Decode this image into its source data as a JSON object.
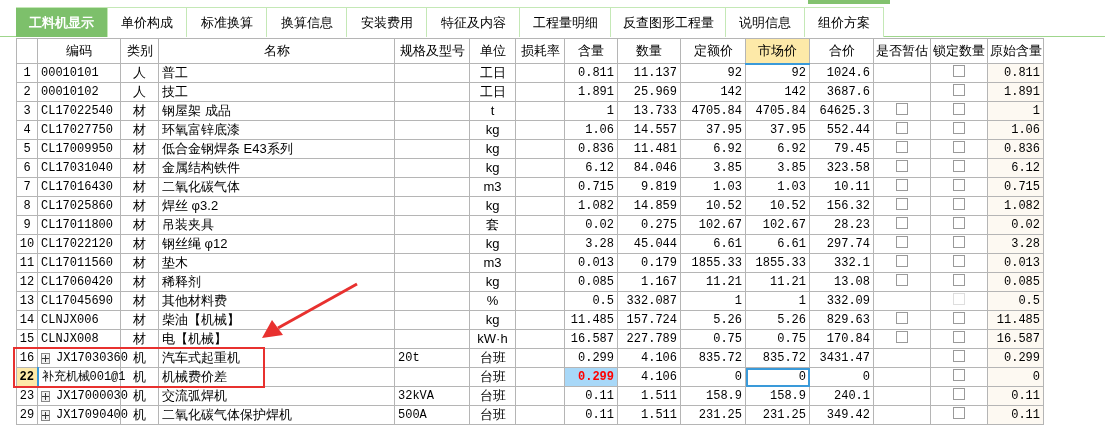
{
  "tabs": [
    {
      "label": "工料机显示",
      "selected": true
    },
    {
      "label": "单价构成",
      "selected": false
    },
    {
      "label": "标准换算",
      "selected": false
    },
    {
      "label": "换算信息",
      "selected": false
    },
    {
      "label": "安装费用",
      "selected": false
    },
    {
      "label": "特征及内容",
      "selected": false
    },
    {
      "label": "工程量明细",
      "selected": false
    },
    {
      "label": "反查图形工程量",
      "selected": false
    },
    {
      "label": "说明信息",
      "selected": false
    },
    {
      "label": "组价方案",
      "selected": false
    }
  ],
  "table": {
    "columns": [
      {
        "label": "编码",
        "selected": false
      },
      {
        "label": "类别",
        "selected": false
      },
      {
        "label": "名称",
        "selected": false
      },
      {
        "label": "规格及型号",
        "selected": false
      },
      {
        "label": "单位",
        "selected": false
      },
      {
        "label": "损耗率",
        "selected": false
      },
      {
        "label": "含量",
        "selected": false
      },
      {
        "label": "数量",
        "selected": false
      },
      {
        "label": "定额价",
        "selected": false
      },
      {
        "label": "市场价",
        "selected": true
      },
      {
        "label": "合价",
        "selected": false
      },
      {
        "label": "是否暂估",
        "selected": false
      },
      {
        "label": "锁定数量",
        "selected": false
      },
      {
        "label": "原始含量",
        "selected": false
      }
    ],
    "rows": [
      {
        "no": "1",
        "code": "00010101",
        "category": "人",
        "name": "普工",
        "unit": "工日",
        "content": "0.811",
        "quantity": "11.137",
        "quota_price": "92",
        "market_price": "92",
        "total": "1024.6",
        "lock": {
          "checked": false,
          "disabled": false
        },
        "original_content": "0.811",
        "selected": false,
        "content_changed": false,
        "expandable": false
      },
      {
        "no": "2",
        "code": "00010102",
        "category": "人",
        "name": "技工",
        "unit": "工日",
        "content": "1.891",
        "quantity": "25.969",
        "quota_price": "142",
        "market_price": "142",
        "total": "3687.6",
        "lock": {
          "checked": false,
          "disabled": false
        },
        "original_content": "1.891",
        "selected": false,
        "content_changed": false,
        "expandable": false
      },
      {
        "no": "3",
        "code": "CL17022540",
        "category": "材",
        "name": "钢屋架 成品",
        "unit": "t",
        "content": "1",
        "quantity": "13.733",
        "quota_price": "4705.84",
        "market_price": "4705.84",
        "total": "64625.3",
        "estimate": {
          "checked": false
        },
        "lock": {
          "checked": false,
          "disabled": false
        },
        "original_content": "1",
        "selected": false,
        "content_changed": false,
        "expandable": false
      },
      {
        "no": "4",
        "code": "CL17027750",
        "category": "材",
        "name": "环氧富锌底漆",
        "unit": "kg",
        "content": "1.06",
        "quantity": "14.557",
        "quota_price": "37.95",
        "market_price": "37.95",
        "total": "552.44",
        "estimate": {
          "checked": false
        },
        "lock": {
          "checked": false,
          "disabled": false
        },
        "original_content": "1.06",
        "selected": false,
        "content_changed": false,
        "expandable": false
      },
      {
        "no": "5",
        "code": "CL17009950",
        "category": "材",
        "name": "低合金钢焊条 E43系列",
        "unit": "kg",
        "content": "0.836",
        "quantity": "11.481",
        "quota_price": "6.92",
        "market_price": "6.92",
        "total": "79.45",
        "estimate": {
          "checked": false
        },
        "lock": {
          "checked": false,
          "disabled": false
        },
        "original_content": "0.836",
        "selected": false,
        "content_changed": false,
        "expandable": false
      },
      {
        "no": "6",
        "code": "CL17031040",
        "category": "材",
        "name": "金属结构铁件",
        "unit": "kg",
        "content": "6.12",
        "quantity": "84.046",
        "quota_price": "3.85",
        "market_price": "3.85",
        "total": "323.58",
        "estimate": {
          "checked": false
        },
        "lock": {
          "checked": false,
          "disabled": false
        },
        "original_content": "6.12",
        "selected": false,
        "content_changed": false,
        "expandable": false
      },
      {
        "no": "7",
        "code": "CL17016430",
        "category": "材",
        "name": "二氧化碳气体",
        "unit": "m3",
        "content": "0.715",
        "quantity": "9.819",
        "quota_price": "1.03",
        "market_price": "1.03",
        "total": "10.11",
        "estimate": {
          "checked": false
        },
        "lock": {
          "checked": false,
          "disabled": false
        },
        "original_content": "0.715",
        "selected": false,
        "content_changed": false,
        "expandable": false
      },
      {
        "no": "8",
        "code": "CL17025860",
        "category": "材",
        "name": "焊丝 φ3.2",
        "unit": "kg",
        "content": "1.082",
        "quantity": "14.859",
        "quota_price": "10.52",
        "market_price": "10.52",
        "total": "156.32",
        "estimate": {
          "checked": false
        },
        "lock": {
          "checked": false,
          "disabled": false
        },
        "original_content": "1.082",
        "selected": false,
        "content_changed": false,
        "expandable": false
      },
      {
        "no": "9",
        "code": "CL17011800",
        "category": "材",
        "name": "吊装夹具",
        "unit": "套",
        "content": "0.02",
        "quantity": "0.275",
        "quota_price": "102.67",
        "market_price": "102.67",
        "total": "28.23",
        "estimate": {
          "checked": false
        },
        "lock": {
          "checked": false,
          "disabled": false
        },
        "original_content": "0.02",
        "selected": false,
        "content_changed": false,
        "expandable": false
      },
      {
        "no": "10",
        "code": "CL17022120",
        "category": "材",
        "name": "钢丝绳 φ12",
        "unit": "kg",
        "content": "3.28",
        "quantity": "45.044",
        "quota_price": "6.61",
        "market_price": "6.61",
        "total": "297.74",
        "estimate": {
          "checked": false
        },
        "lock": {
          "checked": false,
          "disabled": false
        },
        "original_content": "3.28",
        "selected": false,
        "content_changed": false,
        "expandable": false
      },
      {
        "no": "11",
        "code": "CL17011560",
        "category": "材",
        "name": "垫木",
        "unit": "m3",
        "content": "0.013",
        "quantity": "0.179",
        "quota_price": "1855.33",
        "market_price": "1855.33",
        "total": "332.1",
        "estimate": {
          "checked": false
        },
        "lock": {
          "checked": false,
          "disabled": false
        },
        "original_content": "0.013",
        "selected": false,
        "content_changed": false,
        "expandable": false
      },
      {
        "no": "12",
        "code": "CL17060420",
        "category": "材",
        "name": "稀释剂",
        "unit": "kg",
        "content": "0.085",
        "quantity": "1.167",
        "quota_price": "11.21",
        "market_price": "11.21",
        "total": "13.08",
        "estimate": {
          "checked": false
        },
        "lock": {
          "checked": false,
          "disabled": false
        },
        "original_content": "0.085",
        "selected": false,
        "content_changed": false,
        "expandable": false
      },
      {
        "no": "13",
        "code": "CL17045690",
        "category": "材",
        "name": "其他材料费",
        "unit": "%",
        "content": "0.5",
        "quantity": "332.087",
        "quota_price": "1",
        "market_price": "1",
        "total": "332.09",
        "lock": {
          "checked": false,
          "disabled": true
        },
        "original_content": "0.5",
        "selected": false,
        "content_changed": false,
        "expandable": false
      },
      {
        "no": "14",
        "code": "CLNJX006",
        "category": "材",
        "name": "柴油【机械】",
        "unit": "kg",
        "content": "11.485",
        "quantity": "157.724",
        "quota_price": "5.26",
        "market_price": "5.26",
        "total": "829.63",
        "estimate": {
          "checked": false
        },
        "lock": {
          "checked": false,
          "disabled": false
        },
        "original_content": "11.485",
        "selected": false,
        "content_changed": false,
        "expandable": false
      },
      {
        "no": "15",
        "code": "CLNJX008",
        "category": "材",
        "name": "电【机械】",
        "unit": "kW·h",
        "content": "16.587",
        "quantity": "227.789",
        "quota_price": "0.75",
        "market_price": "0.75",
        "total": "170.84",
        "estimate": {
          "checked": false
        },
        "lock": {
          "checked": false,
          "disabled": false
        },
        "original_content": "16.587",
        "selected": false,
        "content_changed": false,
        "expandable": false
      },
      {
        "no": "16",
        "code": "JX17030360",
        "category": "机",
        "name": "汽车式起重机",
        "spec": "20t",
        "unit": "台班",
        "content": "0.299",
        "quantity": "4.106",
        "quota_price": "835.72",
        "market_price": "835.72",
        "total": "3431.47",
        "lock": {
          "checked": false,
          "disabled": false
        },
        "original_content": "0.299",
        "selected": false,
        "content_changed": false,
        "expandable": true
      },
      {
        "no": "22",
        "code": "补充机械001@1",
        "category": "机",
        "name": "机械费价差",
        "unit": "台班",
        "content": "0.299",
        "quantity": "4.106",
        "quota_price": "0",
        "market_price": "0",
        "total": "0",
        "lock": {
          "checked": false,
          "disabled": false
        },
        "original_content": "0",
        "selected": true,
        "content_changed": true,
        "expandable": false
      },
      {
        "no": "23",
        "code": "JX17000030",
        "category": "机",
        "name": "交流弧焊机",
        "spec": "32kVA",
        "unit": "台班",
        "content": "0.11",
        "quantity": "1.511",
        "quota_price": "158.9",
        "market_price": "158.9",
        "total": "240.1",
        "lock": {
          "checked": false,
          "disabled": false
        },
        "original_content": "0.11",
        "selected": false,
        "content_changed": false,
        "expandable": true
      },
      {
        "no": "29",
        "code": "JX17090400",
        "category": "机",
        "name": "二氧化碳气体保护焊机",
        "spec": "500A",
        "unit": "台班",
        "content": "0.11",
        "quantity": "1.511",
        "quota_price": "231.25",
        "market_price": "231.25",
        "total": "349.42",
        "lock": {
          "checked": false,
          "disabled": false
        },
        "original_content": "0.11",
        "selected": false,
        "content_changed": false,
        "expandable": true
      }
    ]
  }
}
